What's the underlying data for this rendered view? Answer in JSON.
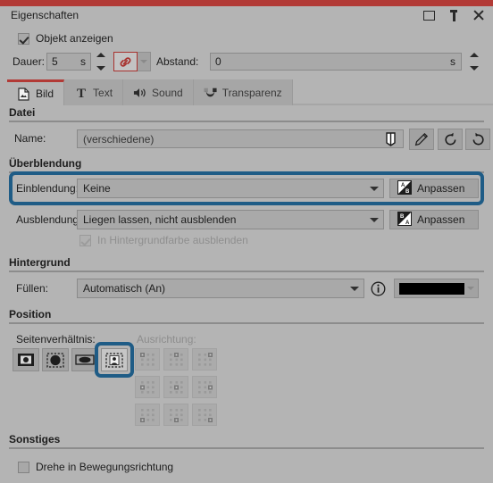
{
  "window": {
    "title": "Eigenschaften",
    "buttons": [
      {
        "name": "restore",
        "icon": "restore-icon"
      },
      {
        "name": "pin",
        "icon": "pin-icon"
      },
      {
        "name": "close",
        "icon": "close-icon"
      }
    ],
    "accent_color": "#b23a36",
    "background_color": "#b4b4b4"
  },
  "show_object": {
    "label": "Objekt anzeigen",
    "checked": true
  },
  "duration": {
    "label": "Dauer:",
    "value": "5",
    "unit": "s",
    "link_active": true
  },
  "distance": {
    "label": "Abstand:",
    "value": "0",
    "unit": "s"
  },
  "tabs": [
    {
      "label": "Bild",
      "icon": "image-icon",
      "active": true
    },
    {
      "label": "Text",
      "icon": "text-icon",
      "active": false
    },
    {
      "label": "Sound",
      "icon": "speaker-icon",
      "active": false
    },
    {
      "label": "Transparenz",
      "icon": "transparency-icon",
      "active": false
    }
  ],
  "sections": {
    "datei": {
      "title": "Datei",
      "name_label": "Name:",
      "name_value": "(verschiedene)",
      "buttons": [
        {
          "name": "crop-icon"
        },
        {
          "name": "pencil-icon"
        },
        {
          "name": "rotate-left-icon"
        },
        {
          "name": "rotate-right-icon"
        }
      ]
    },
    "ueberblendung": {
      "title": "Überblendung",
      "einblendung_label": "Einblendung:",
      "einblendung_value": "Keine",
      "einblendung_button": "Anpassen",
      "ausblendung_label": "Ausblendung:",
      "ausblendung_value": "Liegen lassen, nicht ausblenden",
      "ausblendung_button": "Anpassen",
      "bgfade_label": "In Hintergrundfarbe ausblenden",
      "bgfade_checked": true,
      "bgfade_disabled": true,
      "highlight_color": "#1f5c86"
    },
    "hintergrund": {
      "title": "Hintergrund",
      "fuellen_label": "Füllen:",
      "fuellen_value": "Automatisch (An)",
      "info_icon": "info-icon",
      "color_value": "#000000"
    },
    "position": {
      "title": "Position",
      "aspect_label": "Seitenverhältnis:",
      "aspect_options": [
        {
          "name": "aspect-original-icon",
          "selected": false
        },
        {
          "name": "aspect-fill-icon",
          "selected": false
        },
        {
          "name": "aspect-stretch-icon",
          "selected": false
        },
        {
          "name": "aspect-fit-icon",
          "selected": true
        }
      ],
      "align_label": "Ausrichtung:",
      "align_disabled": true,
      "align_options": [
        "align-top-left",
        "align-top-center",
        "align-top-right",
        "align-middle-left",
        "align-middle-center",
        "align-middle-right",
        "align-bottom-left",
        "align-bottom-center",
        "align-bottom-right"
      ]
    },
    "sonstiges": {
      "title": "Sonstiges",
      "rotate_label": "Drehe in Bewegungsrichtung",
      "rotate_checked": false
    }
  }
}
